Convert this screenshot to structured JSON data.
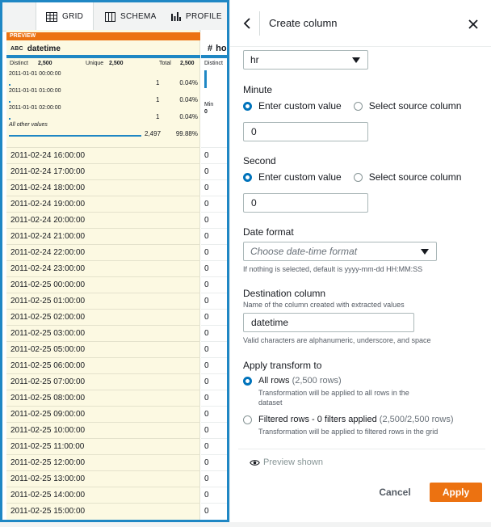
{
  "tabs": [
    {
      "label": "GRID",
      "icon": "grid-icon",
      "active": true
    },
    {
      "label": "SCHEMA",
      "icon": "schema-icon",
      "active": false
    },
    {
      "label": "PROFILE",
      "icon": "profile-icon",
      "active": false
    }
  ],
  "grid": {
    "preview_tag": "PREVIEW",
    "column1": {
      "type_badge": "ABC",
      "name": "datetime",
      "stats": {
        "distinct_label": "Distinct",
        "distinct": "2,500",
        "unique_label": "Unique",
        "unique": "2,500",
        "total_label": "Total",
        "total": "2,500"
      },
      "top_values": [
        {
          "label": "2011-01-01 00:00:00",
          "count": "1",
          "pct": "0.04%",
          "fraction": 0.0004
        },
        {
          "label": "2011-01-01 01:00:00",
          "count": "1",
          "pct": "0.04%",
          "fraction": 0.0004
        },
        {
          "label": "2011-01-01 02:00:00",
          "count": "1",
          "pct": "0.04%",
          "fraction": 0.0004
        }
      ],
      "other": {
        "label": "All other values",
        "count": "2,497",
        "pct": "99.88%",
        "fraction": 0.9988
      },
      "rows": [
        "2011-02-24 16:00:00",
        "2011-02-24 17:00:00",
        "2011-02-24 18:00:00",
        "2011-02-24 19:00:00",
        "2011-02-24 20:00:00",
        "2011-02-24 21:00:00",
        "2011-02-24 22:00:00",
        "2011-02-24 23:00:00",
        "2011-02-25 00:00:00",
        "2011-02-25 01:00:00",
        "2011-02-25 02:00:00",
        "2011-02-25 03:00:00",
        "2011-02-25 05:00:00",
        "2011-02-25 06:00:00",
        "2011-02-25 07:00:00",
        "2011-02-25 08:00:00",
        "2011-02-25 09:00:00",
        "2011-02-25 10:00:00",
        "2011-02-25 11:00:00",
        "2011-02-25 12:00:00",
        "2011-02-25 13:00:00",
        "2011-02-25 14:00:00",
        "2011-02-25 15:00:00"
      ]
    },
    "column2": {
      "type_badge": "#",
      "name_partial": "ho",
      "distinct_label": "Distinct",
      "min_label": "Min",
      "min_value": "0",
      "rows": [
        "0",
        "0",
        "0",
        "0",
        "0",
        "0",
        "0",
        "0",
        "0",
        "0",
        "0",
        "0",
        "0",
        "0",
        "0",
        "0",
        "0",
        "0",
        "0",
        "0",
        "0",
        "0",
        "0"
      ]
    }
  },
  "panel": {
    "title": "Create column",
    "hour_select_value": "hr",
    "minute": {
      "label": "Minute",
      "option_custom": "Enter custom value",
      "option_source": "Select source column",
      "value": "0"
    },
    "second": {
      "label": "Second",
      "option_custom": "Enter custom value",
      "option_source": "Select source column",
      "value": "0"
    },
    "date_format": {
      "label": "Date format",
      "placeholder": "Choose date-time format",
      "hint": "If nothing is selected, default is yyyy-mm-dd HH:MM:SS"
    },
    "destination": {
      "label": "Destination column",
      "description": "Name of the column created with extracted values",
      "value": "datetime",
      "hint": "Valid characters are alphanumeric, underscore, and space"
    },
    "apply_transform": {
      "label": "Apply transform to",
      "all_rows": {
        "title": "All rows",
        "count": "(2,500 rows)",
        "desc": "Transformation will be applied to all rows in the dataset"
      },
      "filtered_rows": {
        "title": "Filtered rows - 0 filters applied",
        "count": "(2,500/2,500 rows)",
        "desc": "Transformation will be applied to filtered rows in the grid"
      }
    },
    "preview_shown": "Preview shown",
    "cancel_label": "Cancel",
    "apply_label": "Apply"
  },
  "colors": {
    "accent_blue": "#1f87c4",
    "radio_blue": "#0073bb",
    "apply_orange": "#ec7211",
    "preview_bg": "#fcf9e2"
  }
}
